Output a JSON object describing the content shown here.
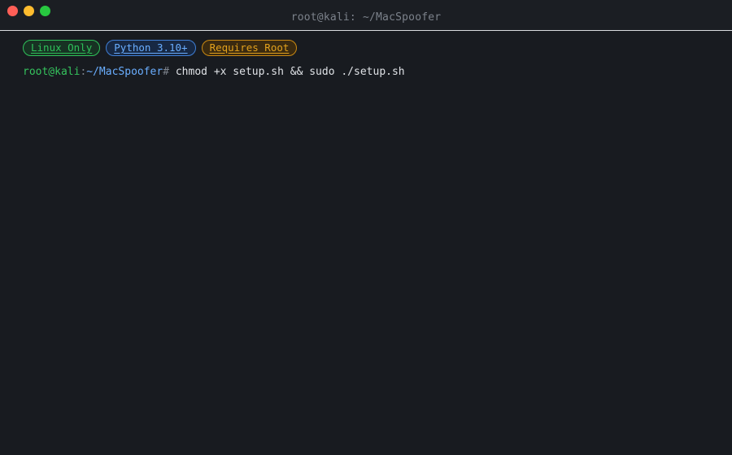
{
  "window": {
    "title": "root@kali: ~/MacSpoofer",
    "controls": {
      "close_icon": "close-dot",
      "minimize_icon": "minimize-dot",
      "maximize_icon": "maximize-dot"
    }
  },
  "badges": [
    {
      "label": "Linux Only",
      "color": "#2fc15a"
    },
    {
      "label": "Python 3.10+",
      "color": "#6aaeff"
    },
    {
      "label": "Requires Root",
      "color": "#e3a21d"
    }
  ],
  "prompt": {
    "user_host": "root@kali",
    "separator": ":",
    "path": "~/MacSpoofer",
    "symbol": "#",
    "command": "chmod +x setup.sh && sudo ./setup.sh"
  },
  "colors": {
    "background": "#181b20",
    "user": "#35c35d",
    "path": "#6aaeff"
  }
}
